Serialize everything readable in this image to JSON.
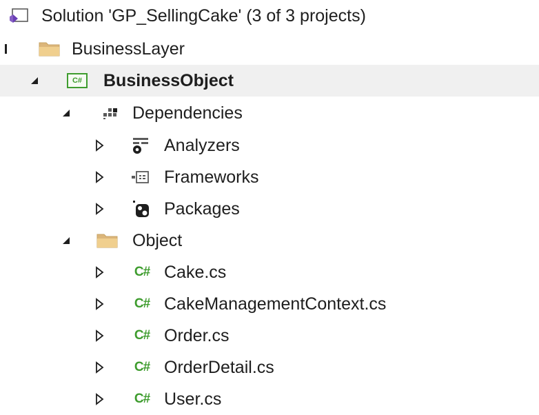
{
  "solution_explorer": {
    "solution": {
      "label": "Solution 'GP_SellingCake' (3 of 3 projects)",
      "icon": "vs-solution-icon"
    },
    "nodes": [
      {
        "label": "BusinessLayer",
        "icon": "folder-icon",
        "expand": "partial"
      },
      {
        "label": "BusinessObject",
        "icon": "csharp-project-icon",
        "expand": "expanded",
        "selected": true
      },
      {
        "label": "Dependencies",
        "icon": "dependencies-icon",
        "expand": "expanded"
      },
      {
        "label": "Analyzers",
        "icon": "analyzers-icon",
        "expand": "collapsed"
      },
      {
        "label": "Frameworks",
        "icon": "frameworks-icon",
        "expand": "collapsed"
      },
      {
        "label": "Packages",
        "icon": "packages-icon",
        "expand": "collapsed"
      },
      {
        "label": "Object",
        "icon": "folder-icon",
        "expand": "expanded"
      },
      {
        "label": "Cake.cs",
        "icon": "csharp-file-icon",
        "expand": "collapsed"
      },
      {
        "label": "CakeManagementContext.cs",
        "icon": "csharp-file-icon",
        "expand": "collapsed"
      },
      {
        "label": "Order.cs",
        "icon": "csharp-file-icon",
        "expand": "collapsed"
      },
      {
        "label": "OrderDetail.cs",
        "icon": "csharp-file-icon",
        "expand": "collapsed"
      },
      {
        "label": "User.cs",
        "icon": "csharp-file-icon",
        "expand": "collapsed"
      }
    ],
    "glyphs": {
      "csharp_file": "C#",
      "csharp_project": "C#"
    },
    "colors": {
      "csharp_green": "#3e9c2e",
      "folder_yellow": "#e8c276",
      "vs_purple": "#865fc5",
      "selection_bg": "#f0f0f0"
    }
  }
}
